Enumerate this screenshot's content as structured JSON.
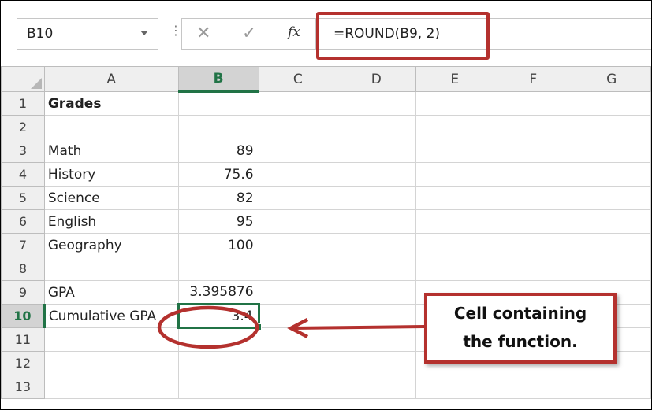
{
  "formula_bar": {
    "name_box": "B10",
    "formula": "=ROUND(B9, 2)",
    "icons": {
      "more": "more-dots-icon",
      "cancel": "cancel-x-icon",
      "enter": "enter-check-icon",
      "fx": "insert-function-icon"
    },
    "cancel_glyph": "✕",
    "enter_glyph": "✓",
    "fx_glyph": "fx",
    "dots_glyph": "⋮"
  },
  "sheet": {
    "columns": [
      "A",
      "B",
      "C",
      "D",
      "E",
      "F",
      "G"
    ],
    "active_column": "B",
    "active_row": "10",
    "rows": [
      {
        "num": "1",
        "a": "Grades",
        "b": ""
      },
      {
        "num": "2",
        "a": "",
        "b": ""
      },
      {
        "num": "3",
        "a": "Math",
        "b": "89"
      },
      {
        "num": "4",
        "a": "History",
        "b": "75.6"
      },
      {
        "num": "5",
        "a": "Science",
        "b": "82"
      },
      {
        "num": "6",
        "a": "English",
        "b": "95"
      },
      {
        "num": "7",
        "a": "Geography",
        "b": "100"
      },
      {
        "num": "8",
        "a": "",
        "b": ""
      },
      {
        "num": "9",
        "a": "GPA",
        "b": "3.395876"
      },
      {
        "num": "10",
        "a": "Cumulative GPA",
        "b": "3.4"
      },
      {
        "num": "11",
        "a": "",
        "b": ""
      },
      {
        "num": "12",
        "a": "",
        "b": ""
      },
      {
        "num": "13",
        "a": "",
        "b": ""
      }
    ]
  },
  "callout": {
    "line1": "Cell containing",
    "line2": "the function."
  },
  "colors": {
    "accent_green": "#217346",
    "annotation_red": "#b4312e"
  }
}
